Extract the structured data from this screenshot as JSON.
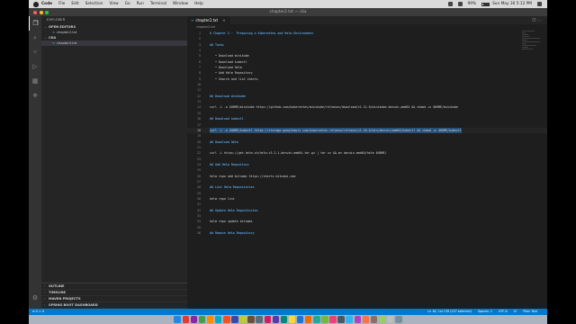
{
  "menubar": {
    "items": [
      "Code",
      "File",
      "Edit",
      "Selection",
      "View",
      "Go",
      "Run",
      "Terminal",
      "Window",
      "Help"
    ],
    "battery": "99%",
    "clock": "Sun May 30  5:12 PM"
  },
  "window": {
    "title": "chapter2.txt — cka"
  },
  "activitybar": {
    "icons": [
      "files-icon",
      "search-icon",
      "source-control-icon",
      "run-debug-icon",
      "extensions-icon",
      "kubernetes-icon"
    ],
    "bottom_icon": "gear-icon"
  },
  "sidebar": {
    "title": "EXPLORER",
    "open_editors": {
      "label": "OPEN EDITORS",
      "files": [
        {
          "name": "chapter2.txt"
        }
      ]
    },
    "workspace": {
      "label": "CKA",
      "files": [
        {
          "name": "chapter2.txt"
        }
      ]
    },
    "bottom_sections": [
      "OUTLINE",
      "TIMELINE",
      "MAVEN PROJECTS",
      "SPRING BOOT DASHBOARD"
    ]
  },
  "editor": {
    "tab": {
      "name": "chapter2.txt"
    },
    "breadcrumb": "chapter2.txt",
    "lines": [
      {
        "n": "1",
        "text": "# Chapter 2 -  Preparing a Kubernetes and Helm Environment",
        "kind": "heading"
      },
      {
        "n": "2",
        "text": "",
        "kind": "text"
      },
      {
        "n": "3",
        "text": "## Tasks",
        "kind": "heading"
      },
      {
        "n": "4",
        "text": "",
        "kind": "text"
      },
      {
        "n": "5",
        "text": "   • Download minikube",
        "kind": "list"
      },
      {
        "n": "6",
        "text": "   • Download kubectl",
        "kind": "list"
      },
      {
        "n": "7",
        "text": "   • Download Helm",
        "kind": "list"
      },
      {
        "n": "8",
        "text": "   • Add Helm Repository",
        "kind": "list"
      },
      {
        "n": "9",
        "text": "   • Search and list charts",
        "kind": "list"
      },
      {
        "n": "10",
        "text": "",
        "kind": "text"
      },
      {
        "n": "11",
        "text": "",
        "kind": "text"
      },
      {
        "n": "12",
        "text": "## Download minikube",
        "kind": "heading"
      },
      {
        "n": "13",
        "text": "",
        "kind": "text"
      },
      {
        "n": "14",
        "text": "curl -L -o $HOME/minikube https://github.com/kubernetes/minikube/releases/download/v1.11.0/minikube-darwin-amd64 && chmod +x $HOME/minikube",
        "kind": "text"
      },
      {
        "n": "15",
        "text": "",
        "kind": "text"
      },
      {
        "n": "16",
        "text": "## Download kubectl",
        "kind": "heading"
      },
      {
        "n": "17",
        "text": "",
        "kind": "text"
      },
      {
        "n": "18",
        "text": "curl -L -o $HOME/kubectl https://storage.googleapis.com/kubernetes-release/release/v1.18.0/bin/darwin/amd64/kubectl && chmod +x $HOME/kubectl",
        "kind": "text",
        "selected": true,
        "current": true
      },
      {
        "n": "19",
        "text": "",
        "kind": "text"
      },
      {
        "n": "20",
        "text": "## Download Helm",
        "kind": "heading"
      },
      {
        "n": "21",
        "text": "",
        "kind": "text"
      },
      {
        "n": "22",
        "text": "curl -L https://get.helm.sh/helm-v3.2.1-darwin-amd64.tar.gz | tar xz && mv darwin-amd64/helm $HOME/",
        "kind": "text"
      },
      {
        "n": "23",
        "text": "",
        "kind": "text"
      },
      {
        "n": "24",
        "text": "## Add Helm Repository",
        "kind": "heading"
      },
      {
        "n": "25",
        "text": "",
        "kind": "text"
      },
      {
        "n": "26",
        "text": "helm repo add bitnami https://charts.bitnami.com",
        "kind": "text"
      },
      {
        "n": "27",
        "text": "",
        "kind": "text"
      },
      {
        "n": "28",
        "text": "## List Helm Repositories",
        "kind": "heading"
      },
      {
        "n": "29",
        "text": "",
        "kind": "text"
      },
      {
        "n": "30",
        "text": "helm repo list",
        "kind": "text"
      },
      {
        "n": "31",
        "text": "",
        "kind": "text"
      },
      {
        "n": "32",
        "text": "## Update Helm Repositories",
        "kind": "heading"
      },
      {
        "n": "33",
        "text": "",
        "kind": "text"
      },
      {
        "n": "34",
        "text": "helm repo update bitnami",
        "kind": "text"
      },
      {
        "n": "35",
        "text": "",
        "kind": "text"
      },
      {
        "n": "36",
        "text": "## Remove Helm Repository",
        "kind": "heading"
      }
    ]
  },
  "statusbar": {
    "left": [
      "⊗ 0  ⚠ 0"
    ],
    "right": [
      "Ln 18, Col 139 (137 selected)",
      "Spaces: 2",
      "UTF-8",
      "LF",
      "Plain Text"
    ]
  },
  "dock": {
    "colors": [
      "#1e88e5",
      "#e53935",
      "#8e24aa",
      "#43a047",
      "#fb8c00",
      "#00acc1",
      "#f4511e",
      "#3949ab",
      "#c0ca33",
      "#6d4c41",
      "#546e7a",
      "#d81b60",
      "#5e35b1",
      "#00897b",
      "#fdd835",
      "#1976d2",
      "#ef6c00",
      "#26a69a",
      "#7cb342",
      "#ec407a",
      "#455a64",
      "#29b6f6",
      "#ab47bc",
      "#ff7043",
      "#8d6e63",
      "#9ccc65",
      "#bdbdbd",
      "#78909c"
    ]
  }
}
